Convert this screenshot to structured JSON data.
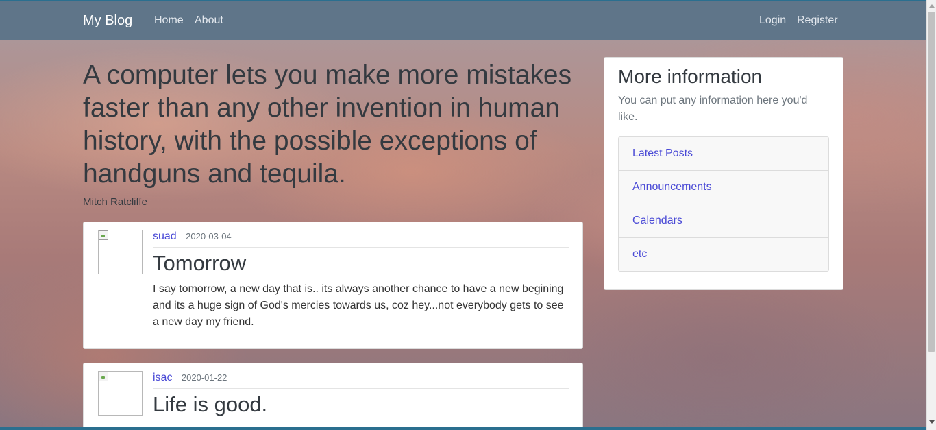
{
  "navbar": {
    "brand": "My Blog",
    "left_links": [
      "Home",
      "About"
    ],
    "right_links": [
      "Login",
      "Register"
    ]
  },
  "quote": {
    "text": "A computer lets you make more mistakes faster than any other invention in human history, with the possible exceptions of handguns and tequila.",
    "author": "Mitch Ratcliffe"
  },
  "posts": [
    {
      "author": "suad",
      "date": "2020-03-04",
      "title": "Tomorrow",
      "body": "I say tomorrow, a new day that is.. its always another chance to have a new begining and its a huge sign of God's mercies towards us, coz hey...not everybody gets to see a new day my friend."
    },
    {
      "author": "isac",
      "date": "2020-01-22",
      "title": "Life is good."
    }
  ],
  "sidebar": {
    "title": "More information",
    "description": "You can put any information here you'd like.",
    "links": [
      "Latest Posts",
      "Announcements",
      "Calendars",
      "etc"
    ]
  },
  "colors": {
    "navbar": "#5f7589",
    "link": "#4a4ad6"
  }
}
